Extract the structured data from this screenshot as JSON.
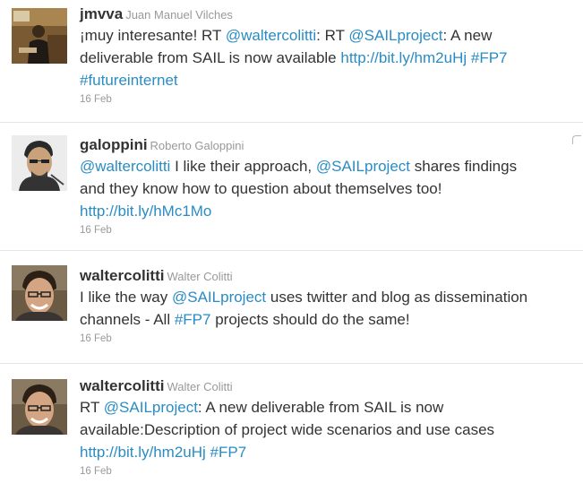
{
  "tweets": [
    {
      "screen_name": "jmvva",
      "full_name": "Juan Manuel Vilches",
      "lines": [
        [
          {
            "text": "¡muy interesante! RT ",
            "link": false
          },
          {
            "text": "@waltercolitti",
            "link": true
          },
          {
            "text": ": RT ",
            "link": false
          },
          {
            "text": "@SAILproject",
            "link": true
          },
          {
            "text": ": A new",
            "link": false
          }
        ],
        [
          {
            "text": "deliverable from SAIL is now available ",
            "link": false
          },
          {
            "text": "http://bit.ly/hm2uHj",
            "link": true
          },
          {
            "text": " ",
            "link": false
          },
          {
            "text": "#FP7",
            "link": true
          }
        ],
        [
          {
            "text": "#futureinternet",
            "link": true
          }
        ]
      ],
      "time": "16 Feb"
    },
    {
      "screen_name": "galoppini",
      "full_name": "Roberto Galoppini",
      "lines": [
        [
          {
            "text": "@waltercolitti",
            "link": true
          },
          {
            "text": " I like their approach, ",
            "link": false
          },
          {
            "text": "@SAILproject",
            "link": true
          },
          {
            "text": " shares findings",
            "link": false
          }
        ],
        [
          {
            "text": "and they know how to question about themselves too!",
            "link": false
          }
        ],
        [
          {
            "text": "http://bit.ly/hMc1Mo",
            "link": true
          }
        ]
      ],
      "time": "16 Feb"
    },
    {
      "screen_name": "waltercolitti",
      "full_name": "Walter Colitti",
      "lines": [
        [
          {
            "text": "I like the way ",
            "link": false
          },
          {
            "text": "@SAILproject",
            "link": true
          },
          {
            "text": " uses twitter and blog as dissemination",
            "link": false
          }
        ],
        [
          {
            "text": "channels - All ",
            "link": false
          },
          {
            "text": "#FP7",
            "link": true
          },
          {
            "text": " projects should do the same!",
            "link": false
          }
        ]
      ],
      "time": "16 Feb"
    },
    {
      "screen_name": "waltercolitti",
      "full_name": "Walter Colitti",
      "lines": [
        [
          {
            "text": "RT ",
            "link": false
          },
          {
            "text": "@SAILproject",
            "link": true
          },
          {
            "text": ": A new deliverable from SAIL is now",
            "link": false
          }
        ],
        [
          {
            "text": "available:Description of project wide scenarios and use cases",
            "link": false
          }
        ],
        [
          {
            "text": "http://bit.ly/hm2uHj",
            "link": true
          },
          {
            "text": " ",
            "link": false
          },
          {
            "text": "#FP7",
            "link": true
          }
        ]
      ],
      "time": "16 Feb"
    }
  ]
}
